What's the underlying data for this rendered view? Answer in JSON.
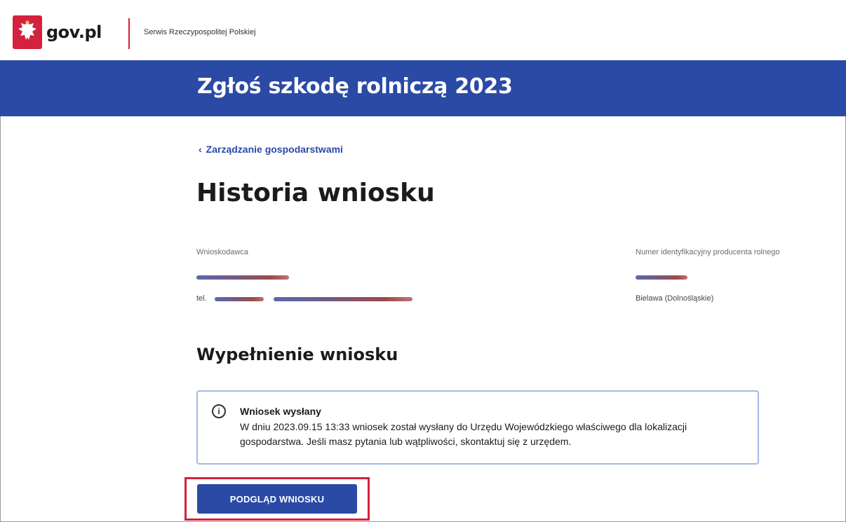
{
  "header": {
    "logo_text": "gov.pl",
    "service_name": "Serwis Rzeczypospolitej Polskiej"
  },
  "banner": {
    "title": "Zgłoś szkodę rolniczą 2023"
  },
  "nav": {
    "back_label": "Zarządzanie gospodarstwami"
  },
  "page": {
    "title": "Historia wniosku"
  },
  "applicant": {
    "label": "Wnioskodawca",
    "phone_prefix": "tel."
  },
  "producer": {
    "label": "Numer identyfikacyjny producenta rolnego",
    "location": "Bielawa (Dolnośląskie)"
  },
  "section": {
    "title": "Wypełnienie wniosku"
  },
  "alert": {
    "icon": "info-icon",
    "title": "Wniosek wysłany",
    "body": "W dniu 2023.09.15 13:33 wniosek został wysłany do Urzędu Wojewódzkiego właściwego dla lokalizacji gospodarstwa. Jeśli masz pytania lub wątpliwości, skontaktuj się z urzędem."
  },
  "actions": {
    "preview_label": "PODGLĄD WNIOSKU"
  },
  "colors": {
    "brand_blue": "#2a4aa5",
    "brand_red": "#d4213d",
    "alert_border": "#a9b8e6"
  }
}
